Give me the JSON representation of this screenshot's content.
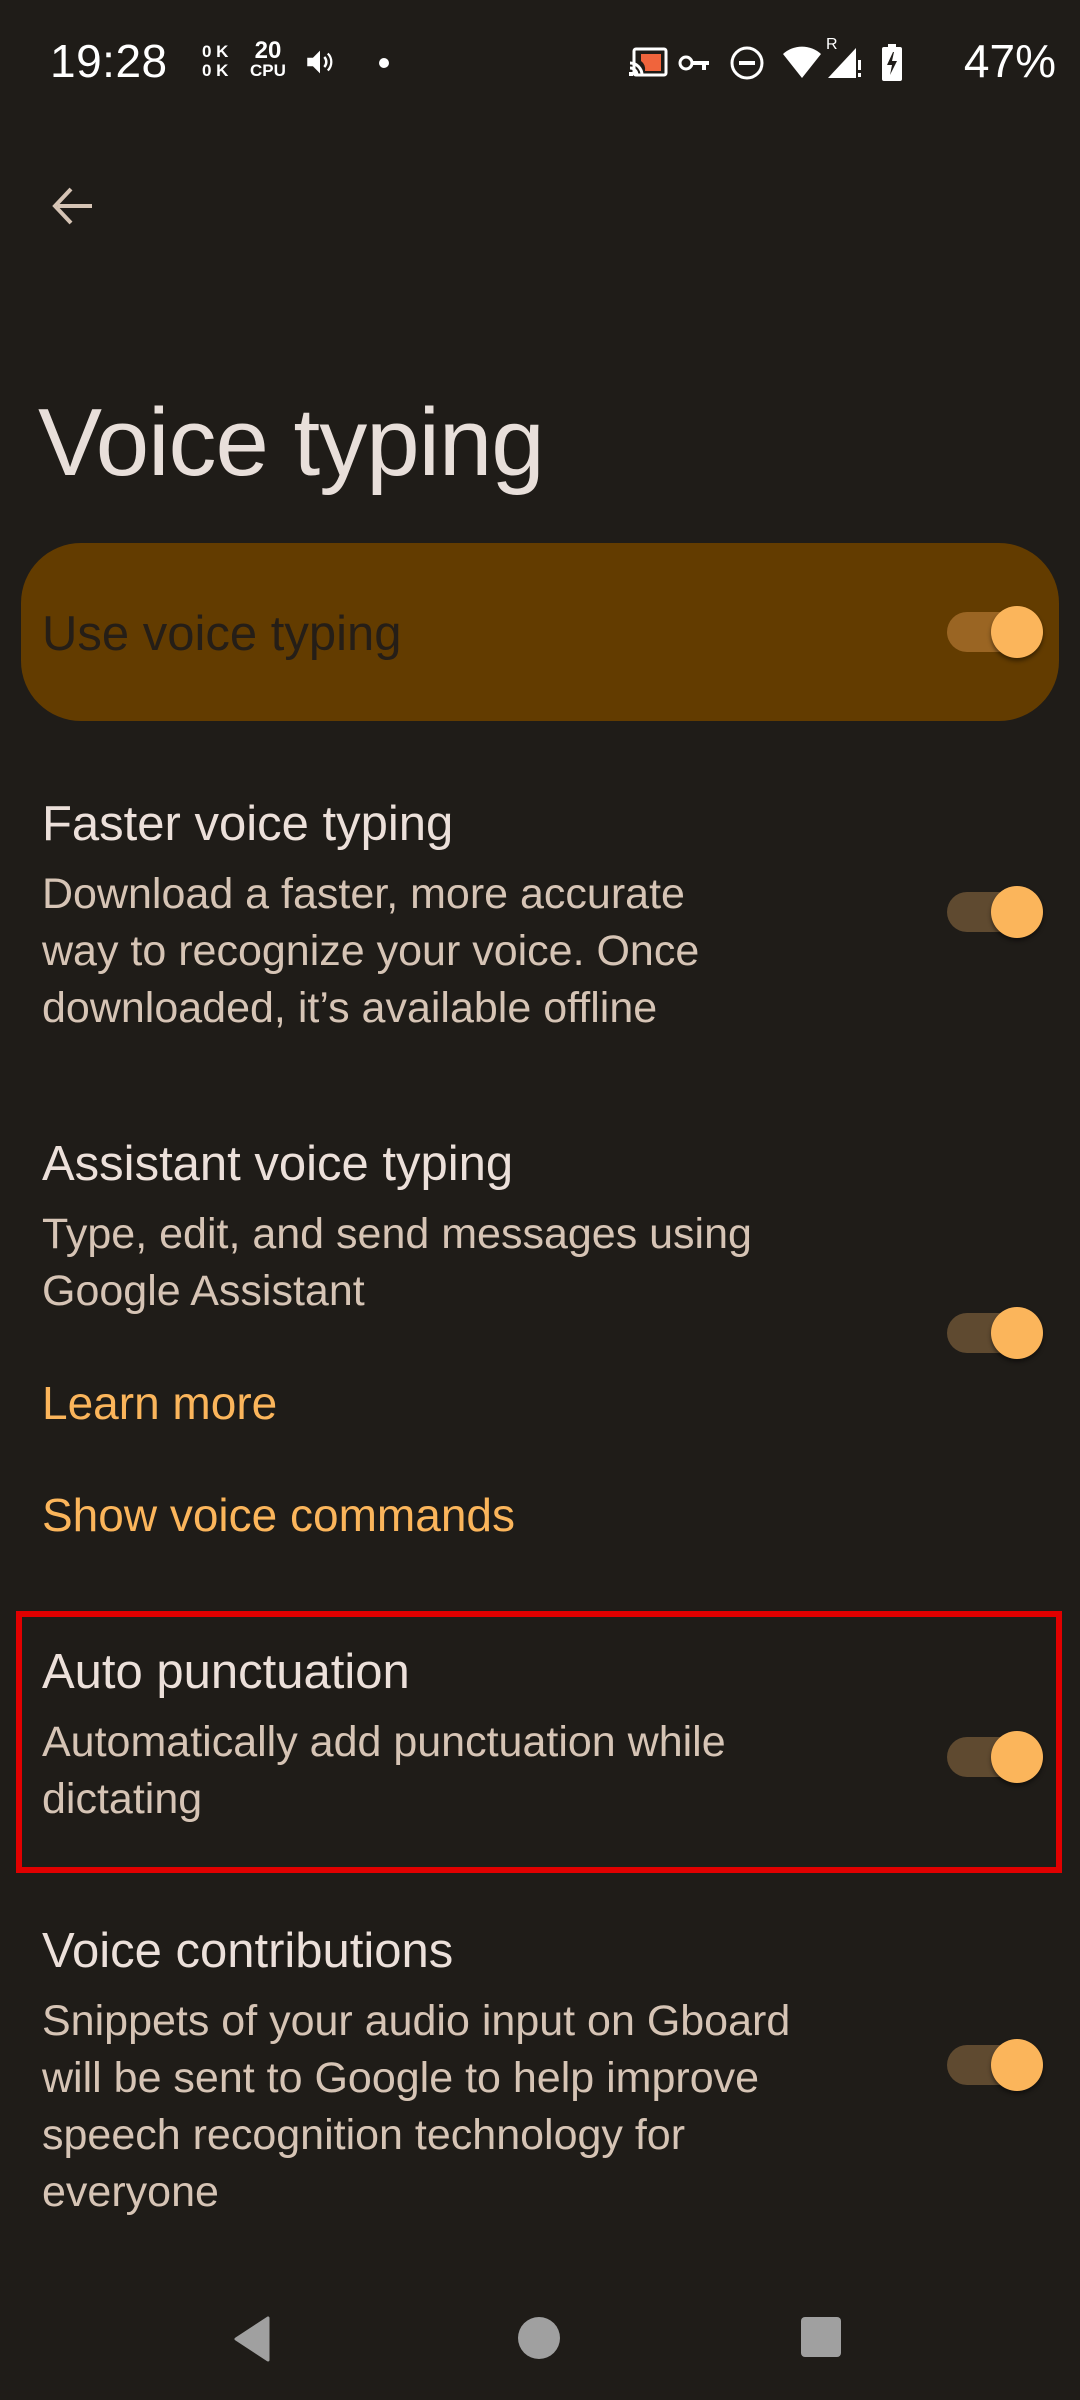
{
  "status_bar": {
    "time": "19:28",
    "net_up": "0 K",
    "net_down": "0 K",
    "cpu_value": "20",
    "cpu_label": "CPU",
    "battery_percent": "47%",
    "roaming_label": "R",
    "icons": [
      "volume-icon",
      "notification-dot-icon",
      "cast-icon",
      "vpn-key-icon",
      "do-not-disturb-icon",
      "wifi-icon",
      "signal-roaming-icon",
      "battery-charging-icon"
    ],
    "cast_color": "#f0643c"
  },
  "header": {
    "back_icon": "arrow-back-icon",
    "title": "Voice typing"
  },
  "main_switch": {
    "label": "Use voice typing",
    "on": true
  },
  "settings": [
    {
      "title": "Faster voice typing",
      "summary_lines": [
        "Download a faster, more accurate",
        "way to recognize your voice. Once",
        "downloaded, it’s available offline"
      ],
      "on": true
    },
    {
      "title": "Assistant voice typing",
      "summary_lines": [
        "Type, edit, and send messages using",
        "Google Assistant"
      ],
      "link": "Learn more",
      "on": true
    },
    {
      "title": "Show voice commands"
    },
    {
      "title": "Auto punctuation",
      "summary_lines": [
        "Automatically add punctuation while",
        "dictating"
      ],
      "on": true,
      "highlighted": true
    },
    {
      "title": "Voice contributions",
      "summary_lines": [
        "Snippets of your audio input on Gboard",
        "will be sent to Google to help improve",
        "speech recognition technology for",
        "everyone"
      ],
      "on": true
    }
  ],
  "colors": {
    "background": "#1f1c18",
    "accent": "#fbb55b",
    "card": "#633c00",
    "highlight_border": "#e00000"
  },
  "nav_bar": {
    "back": "nav-back-icon",
    "home": "nav-home-icon",
    "recents": "nav-recents-icon"
  }
}
